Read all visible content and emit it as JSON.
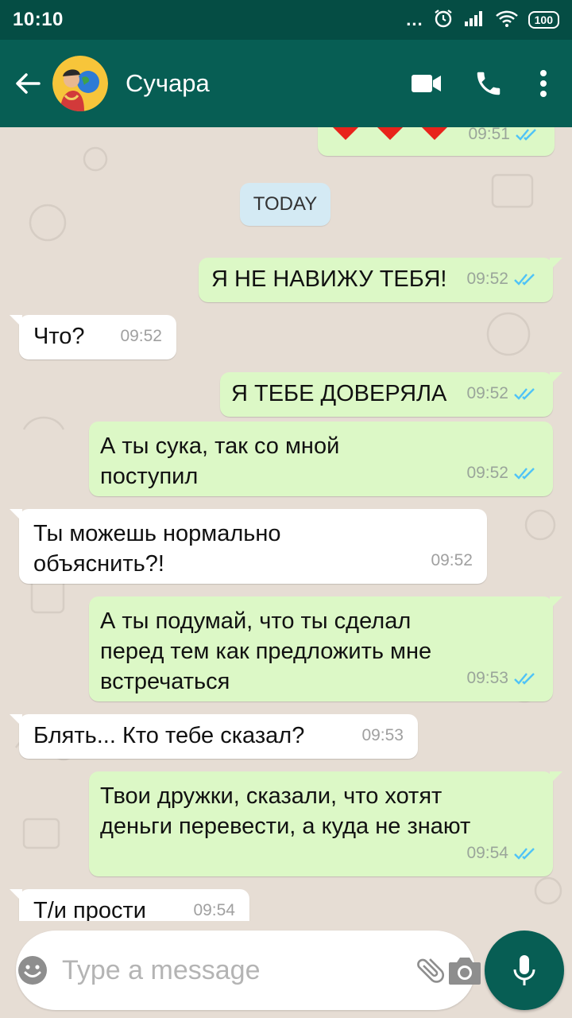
{
  "status_bar": {
    "time": "10:10",
    "dots": "...",
    "battery": "100"
  },
  "header": {
    "contact_name": "Сучара"
  },
  "chat": {
    "day_label": "TODAY",
    "messages": [
      {
        "dir": "out",
        "text": "",
        "time": "09:51",
        "ticks": "✓✓"
      },
      {
        "dir": "out",
        "text": "Я НЕ НАВИЖУ ТЕБЯ!",
        "time": "09:52",
        "ticks": "✓✓"
      },
      {
        "dir": "in",
        "text": "Что?",
        "time": "09:52"
      },
      {
        "dir": "out",
        "text": "Я ТЕБЕ ДОВЕРЯЛА",
        "time": "09:52",
        "ticks": "✓✓"
      },
      {
        "dir": "out",
        "text": "А ты сука, так со мной поступил",
        "time": "09:52",
        "ticks": "✓✓"
      },
      {
        "dir": "in",
        "text": "Ты можешь нормально объяснить?!",
        "time": "09:52"
      },
      {
        "dir": "out",
        "text": "А ты подумай, что ты сделал перед тем как предложить мне встречаться",
        "time": "09:53",
        "ticks": "✓✓"
      },
      {
        "dir": "in",
        "text": "Блять... Кто тебе сказал?",
        "time": "09:53"
      },
      {
        "dir": "out",
        "text": "Твои дружки, сказали, что хотят деньги перевести, а куда не знают",
        "time": "09:54",
        "ticks": "✓✓"
      },
      {
        "dir": "in",
        "text": "Т/и прости",
        "time": "09:54"
      }
    ]
  },
  "composer": {
    "placeholder": "Type a message"
  },
  "colors": {
    "header": "#075e54",
    "status_bar": "#054d44",
    "outgoing": "#dcf8c6",
    "incoming": "#ffffff",
    "tick": "#4fc3f7"
  },
  "icons": [
    "back-arrow-icon",
    "video-call-icon",
    "phone-icon",
    "more-vert-icon",
    "heart-icon",
    "double-check-icon",
    "emoji-icon",
    "attach-icon",
    "camera-icon",
    "mic-icon"
  ]
}
